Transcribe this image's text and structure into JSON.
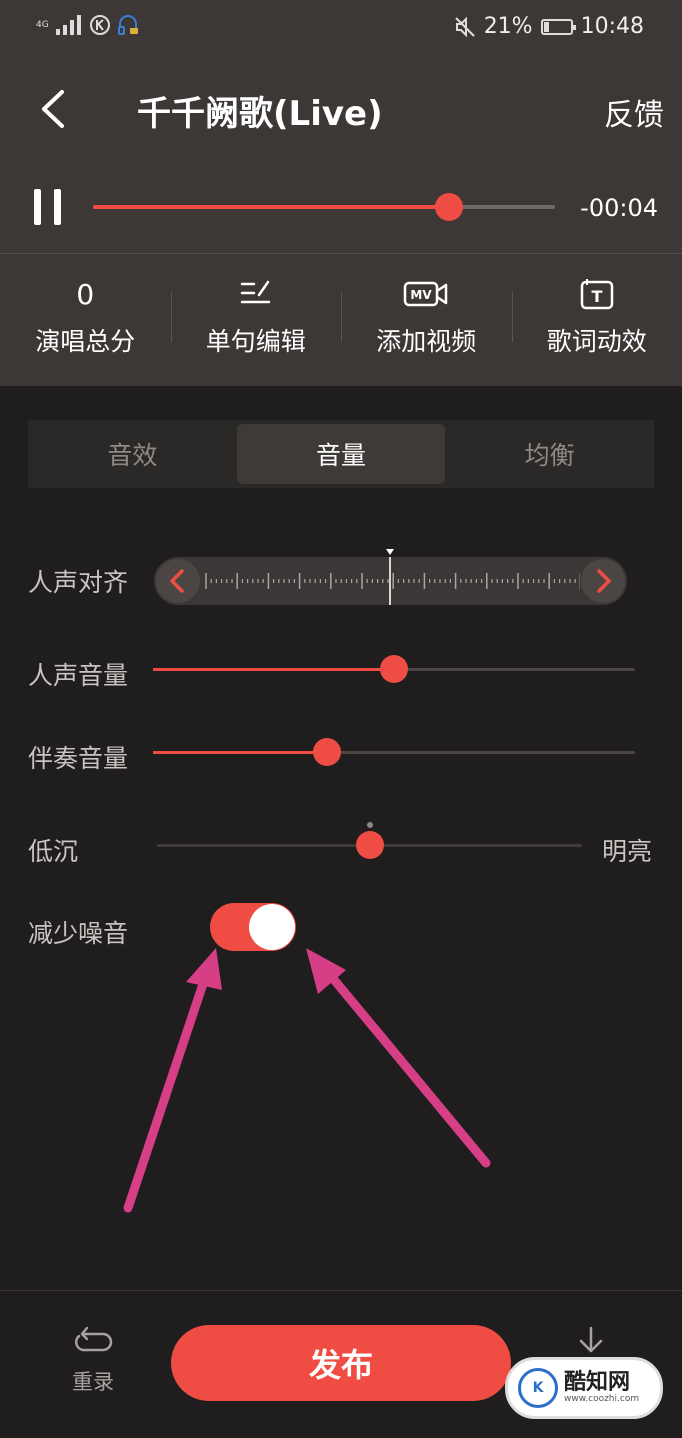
{
  "status_bar": {
    "network": "4G",
    "battery_percent": "21%",
    "battery_level": 0.21,
    "time": "10:48"
  },
  "header": {
    "title": "千千阙歌(Live)",
    "feedback_label": "反馈"
  },
  "playback": {
    "progress": 0.77,
    "time_remaining": "-00:04"
  },
  "toolbar": {
    "score_value": "0",
    "items": [
      {
        "label": "演唱总分"
      },
      {
        "label": "单句编辑"
      },
      {
        "label": "添加视频",
        "icon_text": "MV"
      },
      {
        "label": "歌词动效",
        "icon_text": "T"
      }
    ]
  },
  "tabs": [
    {
      "label": "音效",
      "active": false
    },
    {
      "label": "音量",
      "active": true
    },
    {
      "label": "均衡",
      "active": false
    }
  ],
  "controls": {
    "vocal_align_label": "人声对齐",
    "vocal_volume_label": "人声音量",
    "vocal_volume": 0.5,
    "accompaniment_label": "伴奏音量",
    "accompaniment_volume": 0.36,
    "tone_low_label": "低沉",
    "tone_high_label": "明亮",
    "tone": 0.5,
    "noise_reduction_label": "减少噪音",
    "noise_reduction_on": true
  },
  "bottom": {
    "rerecord_label": "重录",
    "publish_label": "发布"
  },
  "watermark": {
    "name": "酷知网",
    "url": "www.coozhi.com"
  },
  "colors": {
    "accent": "#ef4d43",
    "annotation_arrow": "#d63f86",
    "panel": "#3d3836",
    "background": "#1f1d1d"
  }
}
